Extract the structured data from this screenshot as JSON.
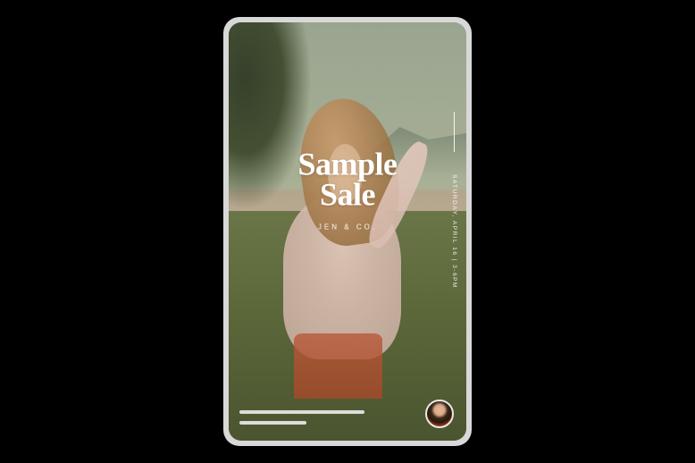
{
  "story": {
    "title_line1": "Sample",
    "title_line2": "Sale",
    "brand": "JEN & CO.",
    "event_info": "SATURDAY, APRIL 16 | 3-6PM"
  }
}
